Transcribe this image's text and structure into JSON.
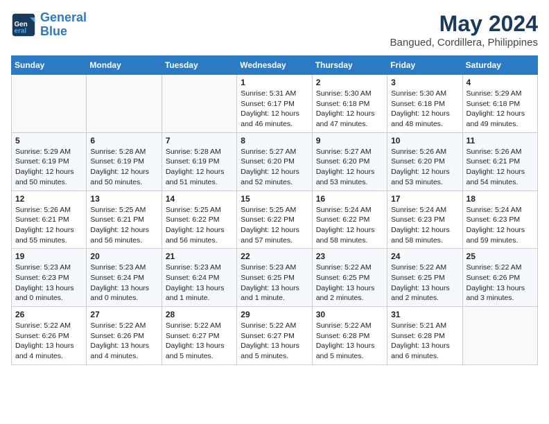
{
  "logo": {
    "line1": "General",
    "line2": "Blue"
  },
  "title": "May 2024",
  "subtitle": "Bangued, Cordillera, Philippines",
  "weekdays": [
    "Sunday",
    "Monday",
    "Tuesday",
    "Wednesday",
    "Thursday",
    "Friday",
    "Saturday"
  ],
  "weeks": [
    [
      {
        "day": "",
        "info": ""
      },
      {
        "day": "",
        "info": ""
      },
      {
        "day": "",
        "info": ""
      },
      {
        "day": "1",
        "info": "Sunrise: 5:31 AM\nSunset: 6:17 PM\nDaylight: 12 hours\nand 46 minutes."
      },
      {
        "day": "2",
        "info": "Sunrise: 5:30 AM\nSunset: 6:18 PM\nDaylight: 12 hours\nand 47 minutes."
      },
      {
        "day": "3",
        "info": "Sunrise: 5:30 AM\nSunset: 6:18 PM\nDaylight: 12 hours\nand 48 minutes."
      },
      {
        "day": "4",
        "info": "Sunrise: 5:29 AM\nSunset: 6:18 PM\nDaylight: 12 hours\nand 49 minutes."
      }
    ],
    [
      {
        "day": "5",
        "info": "Sunrise: 5:29 AM\nSunset: 6:19 PM\nDaylight: 12 hours\nand 50 minutes."
      },
      {
        "day": "6",
        "info": "Sunrise: 5:28 AM\nSunset: 6:19 PM\nDaylight: 12 hours\nand 50 minutes."
      },
      {
        "day": "7",
        "info": "Sunrise: 5:28 AM\nSunset: 6:19 PM\nDaylight: 12 hours\nand 51 minutes."
      },
      {
        "day": "8",
        "info": "Sunrise: 5:27 AM\nSunset: 6:20 PM\nDaylight: 12 hours\nand 52 minutes."
      },
      {
        "day": "9",
        "info": "Sunrise: 5:27 AM\nSunset: 6:20 PM\nDaylight: 12 hours\nand 53 minutes."
      },
      {
        "day": "10",
        "info": "Sunrise: 5:26 AM\nSunset: 6:20 PM\nDaylight: 12 hours\nand 53 minutes."
      },
      {
        "day": "11",
        "info": "Sunrise: 5:26 AM\nSunset: 6:21 PM\nDaylight: 12 hours\nand 54 minutes."
      }
    ],
    [
      {
        "day": "12",
        "info": "Sunrise: 5:26 AM\nSunset: 6:21 PM\nDaylight: 12 hours\nand 55 minutes."
      },
      {
        "day": "13",
        "info": "Sunrise: 5:25 AM\nSunset: 6:21 PM\nDaylight: 12 hours\nand 56 minutes."
      },
      {
        "day": "14",
        "info": "Sunrise: 5:25 AM\nSunset: 6:22 PM\nDaylight: 12 hours\nand 56 minutes."
      },
      {
        "day": "15",
        "info": "Sunrise: 5:25 AM\nSunset: 6:22 PM\nDaylight: 12 hours\nand 57 minutes."
      },
      {
        "day": "16",
        "info": "Sunrise: 5:24 AM\nSunset: 6:22 PM\nDaylight: 12 hours\nand 58 minutes."
      },
      {
        "day": "17",
        "info": "Sunrise: 5:24 AM\nSunset: 6:23 PM\nDaylight: 12 hours\nand 58 minutes."
      },
      {
        "day": "18",
        "info": "Sunrise: 5:24 AM\nSunset: 6:23 PM\nDaylight: 12 hours\nand 59 minutes."
      }
    ],
    [
      {
        "day": "19",
        "info": "Sunrise: 5:23 AM\nSunset: 6:23 PM\nDaylight: 13 hours\nand 0 minutes."
      },
      {
        "day": "20",
        "info": "Sunrise: 5:23 AM\nSunset: 6:24 PM\nDaylight: 13 hours\nand 0 minutes."
      },
      {
        "day": "21",
        "info": "Sunrise: 5:23 AM\nSunset: 6:24 PM\nDaylight: 13 hours\nand 1 minute."
      },
      {
        "day": "22",
        "info": "Sunrise: 5:23 AM\nSunset: 6:25 PM\nDaylight: 13 hours\nand 1 minute."
      },
      {
        "day": "23",
        "info": "Sunrise: 5:22 AM\nSunset: 6:25 PM\nDaylight: 13 hours\nand 2 minutes."
      },
      {
        "day": "24",
        "info": "Sunrise: 5:22 AM\nSunset: 6:25 PM\nDaylight: 13 hours\nand 2 minutes."
      },
      {
        "day": "25",
        "info": "Sunrise: 5:22 AM\nSunset: 6:26 PM\nDaylight: 13 hours\nand 3 minutes."
      }
    ],
    [
      {
        "day": "26",
        "info": "Sunrise: 5:22 AM\nSunset: 6:26 PM\nDaylight: 13 hours\nand 4 minutes."
      },
      {
        "day": "27",
        "info": "Sunrise: 5:22 AM\nSunset: 6:26 PM\nDaylight: 13 hours\nand 4 minutes."
      },
      {
        "day": "28",
        "info": "Sunrise: 5:22 AM\nSunset: 6:27 PM\nDaylight: 13 hours\nand 5 minutes."
      },
      {
        "day": "29",
        "info": "Sunrise: 5:22 AM\nSunset: 6:27 PM\nDaylight: 13 hours\nand 5 minutes."
      },
      {
        "day": "30",
        "info": "Sunrise: 5:22 AM\nSunset: 6:28 PM\nDaylight: 13 hours\nand 5 minutes."
      },
      {
        "day": "31",
        "info": "Sunrise: 5:21 AM\nSunset: 6:28 PM\nDaylight: 13 hours\nand 6 minutes."
      },
      {
        "day": "",
        "info": ""
      }
    ]
  ]
}
